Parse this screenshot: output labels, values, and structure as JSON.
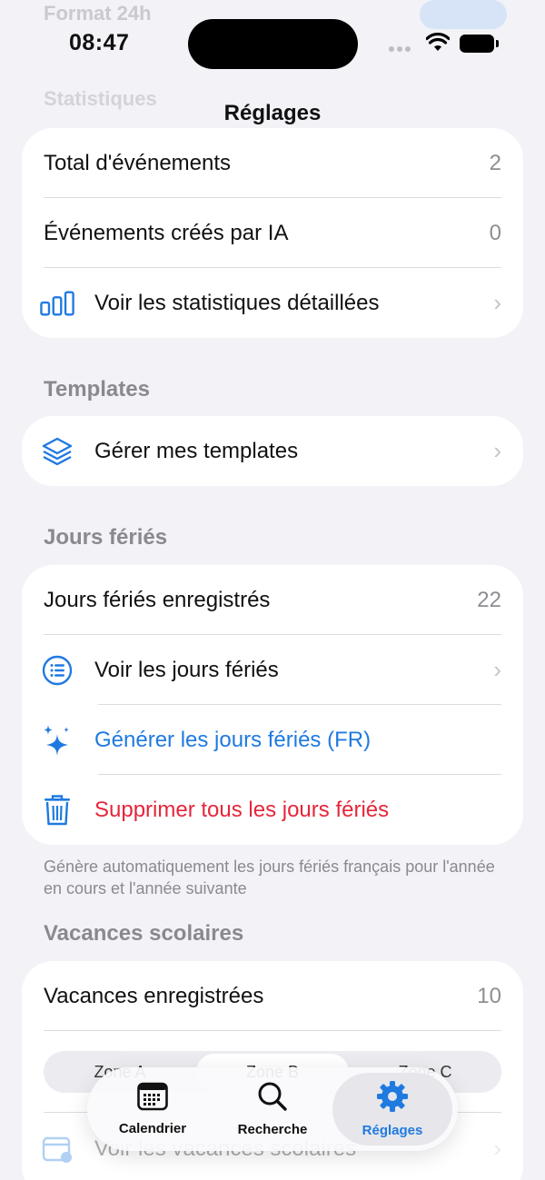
{
  "status_bar": {
    "time": "08:47"
  },
  "behind": {
    "ghost_row": "Format 24h",
    "ghost_header": "Statistiques"
  },
  "nav": {
    "title": "Réglages"
  },
  "stats": {
    "total_label": "Total d'événements",
    "total_value": "2",
    "ia_label": "Événements créés par IA",
    "ia_value": "0",
    "detail_label": "Voir les statistiques détaillées"
  },
  "templates": {
    "header": "Templates",
    "manage_label": "Gérer mes templates"
  },
  "holidays": {
    "header": "Jours fériés",
    "registered_label": "Jours fériés enregistrés",
    "registered_value": "22",
    "view_label": "Voir les jours fériés",
    "generate_label": "Générer les jours fériés (FR)",
    "delete_label": "Supprimer tous les jours fériés",
    "footnote": "Génère automatiquement les jours fériés français pour l'année en cours et l'année suivante"
  },
  "vacations": {
    "header": "Vacances scolaires",
    "registered_label": "Vacances enregistrées",
    "registered_value": "10",
    "zones": [
      "Zone A",
      "Zone B",
      "Zone C"
    ],
    "selected_zone": "Zone B",
    "view_label": "Voir les vacances scolaires"
  },
  "tabbar": {
    "tabs": [
      {
        "label": "Calendrier",
        "icon": "calendar-icon"
      },
      {
        "label": "Recherche",
        "icon": "search-icon"
      },
      {
        "label": "Réglages",
        "icon": "gear-icon"
      }
    ],
    "active": "Réglages"
  },
  "colors": {
    "accent": "#1f7ae0",
    "destructive": "#e5263b",
    "background": "#f2f2f7"
  }
}
